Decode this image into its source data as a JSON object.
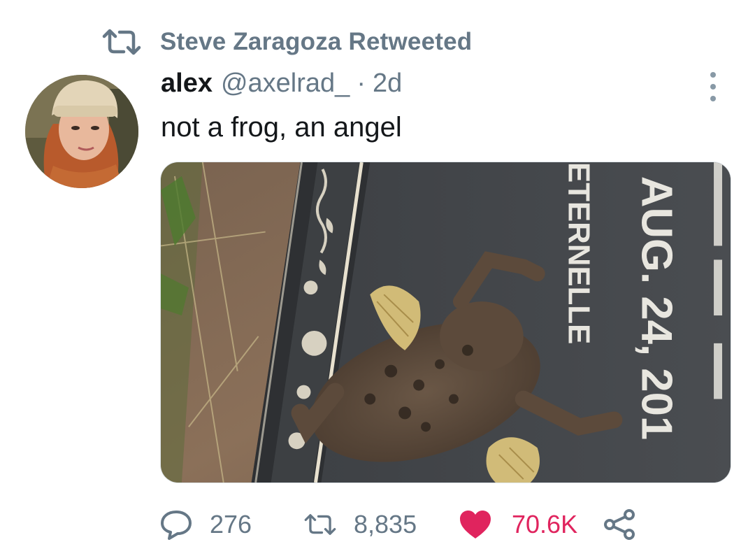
{
  "retweet_banner": {
    "text": "Steve Zaragoza Retweeted",
    "icon": "retweet-icon"
  },
  "tweet": {
    "author_name": "alex",
    "author_handle": "@axelrad_",
    "separator": "·",
    "time": "2d",
    "text": "not a frog, an angel",
    "media": {
      "description_icon": "photo",
      "visible_text": {
        "top_line": "AUG. 24, 201",
        "second_line": "ETERNELLE"
      }
    }
  },
  "actions": {
    "replies": "276",
    "retweets": "8,835",
    "likes": "70.6K",
    "icons": [
      "reply-icon",
      "retweet-icon",
      "heart-icon",
      "share-icon"
    ]
  },
  "colors": {
    "secondary_text": "#657786",
    "like": "#e0245e",
    "text": "#14171a"
  }
}
